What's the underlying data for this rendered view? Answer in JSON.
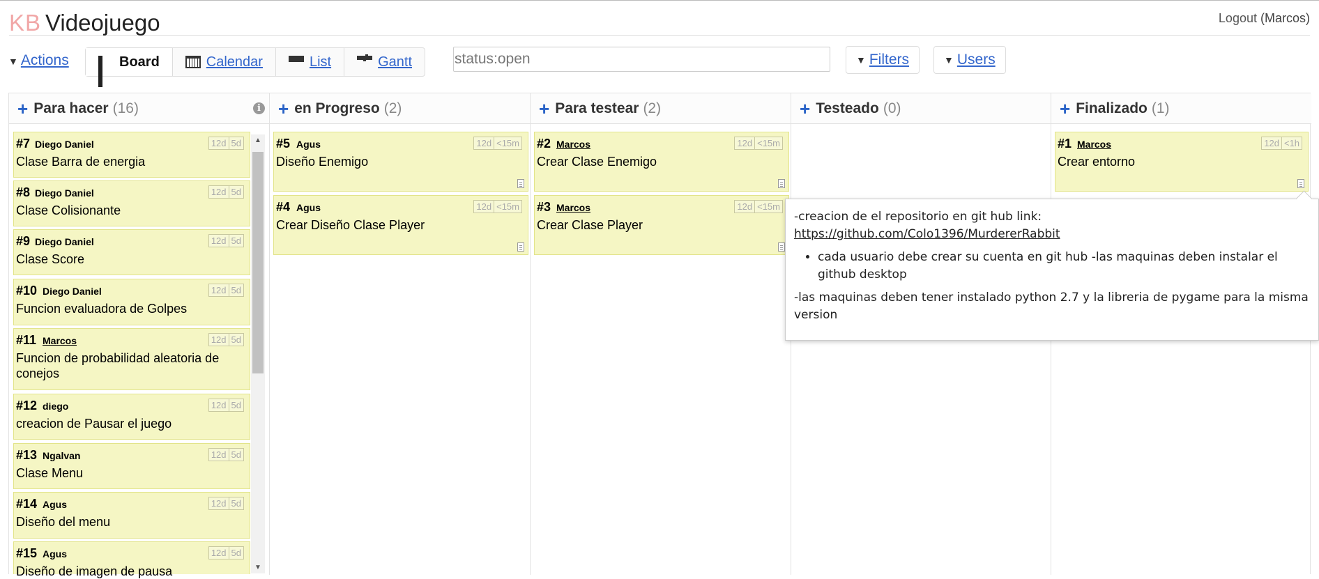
{
  "header": {
    "logo": "KB",
    "project": "Videojuego",
    "logout_label": "Logout",
    "user_display": "(Marcos)"
  },
  "toolbar": {
    "actions_label": "Actions",
    "views": [
      {
        "label": "Board",
        "icon": "board-grid-icon",
        "active": true
      },
      {
        "label": "Calendar",
        "icon": "calendar-icon",
        "active": false
      },
      {
        "label": "List",
        "icon": "list-icon",
        "active": false
      },
      {
        "label": "Gantt",
        "icon": "gantt-icon",
        "active": false
      }
    ],
    "search_value": "status:open",
    "filters_label": "Filters",
    "users_label": "Users"
  },
  "columns": [
    {
      "title": "Para hacer",
      "count": "(16)"
    },
    {
      "title": "en Progreso",
      "count": "(2)"
    },
    {
      "title": "Para testear",
      "count": "(2)"
    },
    {
      "title": "Testeado",
      "count": "(0)"
    },
    {
      "title": "Finalizado",
      "count": "(1)"
    }
  ],
  "tasks": {
    "c0": [
      {
        "id": "#7",
        "user": "Diego Daniel",
        "title": "Clase Barra de energia",
        "age": "12d",
        "time": "5d"
      },
      {
        "id": "#8",
        "user": "Diego Daniel",
        "title": "Clase Colisionante",
        "age": "12d",
        "time": "5d"
      },
      {
        "id": "#9",
        "user": "Diego Daniel",
        "title": "Clase Score",
        "age": "12d",
        "time": "5d"
      },
      {
        "id": "#10",
        "user": "Diego Daniel",
        "title": "Funcion evaluadora de Golpes",
        "age": "12d",
        "time": "5d"
      },
      {
        "id": "#11",
        "user": "Marcos",
        "title": "Funcion de probabilidad aleatoria de conejos",
        "age": "12d",
        "time": "5d"
      },
      {
        "id": "#12",
        "user": "diego",
        "title": "creacion de Pausar el juego",
        "age": "12d",
        "time": "5d"
      },
      {
        "id": "#13",
        "user": "Ngalvan",
        "title": "Clase Menu",
        "age": "12d",
        "time": "5d"
      },
      {
        "id": "#14",
        "user": "Agus",
        "title": "Diseño del menu",
        "age": "12d",
        "time": "5d"
      },
      {
        "id": "#15",
        "user": "Agus",
        "title": "Diseño de imagen de pausa",
        "age": "12d",
        "time": "5d"
      }
    ],
    "c1": [
      {
        "id": "#5",
        "user": "Agus",
        "title": "Diseño Enemigo",
        "age": "12d",
        "time": "<15m"
      },
      {
        "id": "#4",
        "user": "Agus",
        "title": "Crear Diseño Clase Player",
        "age": "12d",
        "time": "<15m"
      }
    ],
    "c2": [
      {
        "id": "#2",
        "user": "Marcos",
        "title": "Crear Clase Enemigo",
        "age": "12d",
        "time": "<15m"
      },
      {
        "id": "#3",
        "user": "Marcos",
        "title": "Crear Clase Player",
        "age": "12d",
        "time": "<15m"
      }
    ],
    "c4": [
      {
        "id": "#1",
        "user": "Marcos",
        "title": "Crear entorno",
        "age": "12d",
        "time": "<1h"
      }
    ]
  },
  "tooltip": {
    "line1": "-creacion de el repositorio en git hub link:",
    "link": "https://github.com/Colo1396/MurdererRabbit",
    "bullet": "cada usuario debe crear su cuenta en git hub -las maquinas deben instalar el github desktop",
    "line3": "-las maquinas deben tener instalado python 2.7 y la libreria de pygame para la misma version"
  },
  "colors": {
    "task_bg": "#f5f6c4",
    "task_border": "#e2e48a",
    "accent": "#2a63c7",
    "link": "#3366cc",
    "logo": "#f1a7a7"
  }
}
